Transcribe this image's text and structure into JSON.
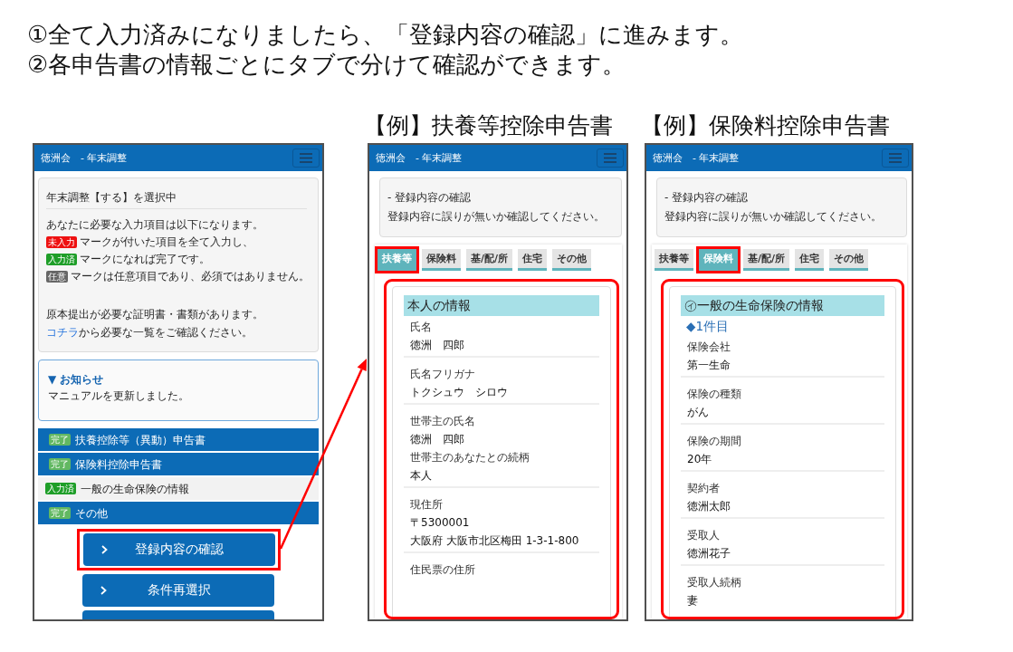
{
  "instructions": [
    "①全て入力済みになりましたら、「登録内容の確認」に進みます。",
    "②各申告書の情報ごとにタブで分けて確認ができます。"
  ],
  "screens": [
    {
      "kind": "status",
      "header": {
        "title": "徳洲会　- 年末調整"
      },
      "info_panel": {
        "heading": "年末調整【する】を選択中",
        "intro": "あなたに必要な入力項目は以下になります。",
        "legend": [
          {
            "badge": "未入力",
            "color": "#ee1111",
            "text": "マークが付いた項目を全て入力し、"
          },
          {
            "badge": "入力済",
            "color": "#1e9e28",
            "text": "マークになれば完了です。"
          },
          {
            "badge": "任意",
            "color": "#666666",
            "text": "マークは任意項目であり、必須ではありません。"
          }
        ],
        "note": "原本提出が必要な証明書・書類があります。",
        "link": "コチラ",
        "link_suffix": "から必要な一覧をご確認ください。"
      },
      "notice": {
        "heading": "▼ お知らせ",
        "text": "マニュアルを更新しました。"
      },
      "forms": [
        {
          "kind": "form",
          "badge": "完了",
          "color": "#62b862",
          "label": "扶養控除等（異動）申告書"
        },
        {
          "kind": "form",
          "badge": "完了",
          "color": "#62b862",
          "label": "保険料控除申告書"
        },
        {
          "kind": "section",
          "badge": "入力済",
          "color": "#1e9e28",
          "label": "一般の生命保険の情報"
        },
        {
          "kind": "form",
          "badge": "完了",
          "color": "#62b862",
          "label": "その他"
        }
      ],
      "buttons": [
        {
          "label": "登録内容の確認",
          "highlighted": true
        },
        {
          "label": "条件再選択",
          "highlighted": false
        },
        {
          "highlighted": false
        }
      ]
    },
    {
      "kind": "review",
      "caption": "【例】扶養等控除申告書",
      "header": {
        "title": "徳洲会　- 年末調整"
      },
      "panel": {
        "heading": "- 登録内容の確認",
        "text": "登録内容に誤りが無いか確認してください。"
      },
      "tabs": [
        {
          "label": "扶養等",
          "selected": true,
          "highlighted": true
        },
        {
          "label": "保険料",
          "selected": false,
          "highlighted": false
        },
        {
          "label": "基/配/所",
          "selected": false,
          "highlighted": false
        },
        {
          "label": "住宅",
          "selected": false,
          "highlighted": false
        },
        {
          "label": "その他",
          "selected": false,
          "highlighted": false
        }
      ],
      "content": {
        "highlighted": true,
        "section_title": "本人の情報",
        "groups": [
          {
            "fields": [
              {
                "label": "氏名",
                "values": [
                  "徳洲　四郎"
                ]
              }
            ]
          },
          {
            "fields": [
              {
                "label": "氏名フリガナ",
                "values": [
                  "トクシュウ　シロウ"
                ]
              }
            ]
          },
          {
            "fields": [
              {
                "label": "世帯主の氏名",
                "values": [
                  "徳洲　四郎"
                ]
              },
              {
                "label": "世帯主のあなたとの続柄",
                "values": [
                  "本人"
                ]
              }
            ]
          },
          {
            "fields": [
              {
                "label": "現住所",
                "values": [
                  "〒5300001",
                  "大阪府 大阪市北区梅田 1-3-1-800"
                ]
              }
            ]
          },
          {
            "fields": [
              {
                "label": "住民票の住所"
              }
            ]
          }
        ]
      }
    },
    {
      "kind": "review",
      "caption": "【例】保険料控除申告書",
      "header": {
        "title": "徳洲会　- 年末調整"
      },
      "panel": {
        "heading": "- 登録内容の確認",
        "text": "登録内容に誤りが無いか確認してください。"
      },
      "tabs": [
        {
          "label": "扶養等",
          "selected": false,
          "highlighted": false
        },
        {
          "label": "保険料",
          "selected": true,
          "highlighted": true
        },
        {
          "label": "基/配/所",
          "selected": false,
          "highlighted": false
        },
        {
          "label": "住宅",
          "selected": false,
          "highlighted": false
        },
        {
          "label": "その他",
          "selected": false,
          "highlighted": false
        }
      ],
      "content": {
        "highlighted": true,
        "section_title": "㋑一般の生命保険の情報",
        "subheading": "◆1件目",
        "groups": [
          {
            "fields": [
              {
                "label": "保険会社",
                "values": [
                  "第一生命"
                ]
              }
            ]
          },
          {
            "fields": [
              {
                "label": "保険の種類",
                "values": [
                  "がん"
                ]
              }
            ]
          },
          {
            "fields": [
              {
                "label": "保険の期間",
                "values": [
                  "20年"
                ]
              }
            ]
          },
          {
            "fields": [
              {
                "label": "契約者",
                "values": [
                  "徳洲太郎"
                ]
              }
            ]
          },
          {
            "fields": [
              {
                "label": "受取人",
                "values": [
                  "徳洲花子"
                ]
              }
            ]
          },
          {
            "fields": [
              {
                "label": "受取人続柄",
                "values": [
                  "妻"
                ]
              }
            ]
          }
        ]
      }
    }
  ]
}
